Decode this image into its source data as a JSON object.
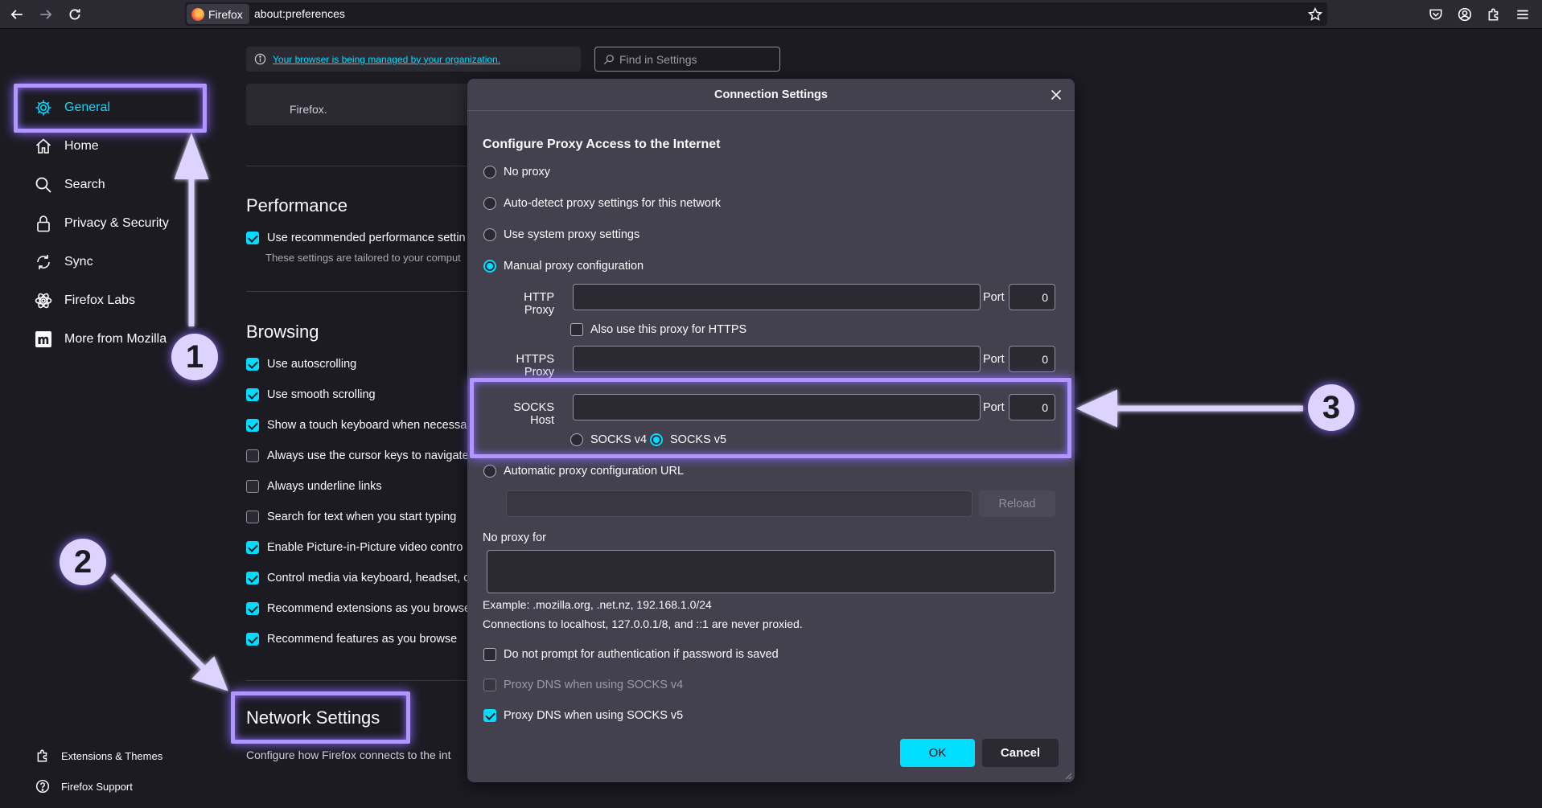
{
  "browser": {
    "identity_label": "Firefox",
    "url": "about:preferences"
  },
  "sidebar": {
    "items": [
      {
        "label": "General",
        "icon": "gear-icon",
        "active": true
      },
      {
        "label": "Home",
        "icon": "home-icon"
      },
      {
        "label": "Search",
        "icon": "search-icon"
      },
      {
        "label": "Privacy & Security",
        "icon": "lock-icon"
      },
      {
        "label": "Sync",
        "icon": "sync-icon"
      },
      {
        "label": "Firefox Labs",
        "icon": "labs-icon"
      },
      {
        "label": "More from Mozilla",
        "icon": "mozilla-icon"
      }
    ],
    "footer": [
      {
        "label": "Extensions & Themes",
        "icon": "puzzle-icon"
      },
      {
        "label": "Firefox Support",
        "icon": "help-icon"
      }
    ]
  },
  "main": {
    "managed_notice": "Your browser is being managed by your organization.",
    "find_placeholder": "Find in Settings",
    "partial_box_text": "Firefox.",
    "performance": {
      "title": "Performance",
      "option": "Use recommended performance settin",
      "subtext": "These settings are tailored to your comput"
    },
    "browsing": {
      "title": "Browsing",
      "options": [
        {
          "label": "Use autoscrolling",
          "checked": true
        },
        {
          "label": "Use smooth scrolling",
          "checked": true
        },
        {
          "label": "Show a touch keyboard when necessa",
          "checked": true
        },
        {
          "label": "Always use the cursor keys to navigate",
          "checked": false
        },
        {
          "label": "Always underline links",
          "checked": false
        },
        {
          "label": "Search for text when you start typing",
          "checked": false
        },
        {
          "label": "Enable Picture-in-Picture video contro",
          "checked": true
        },
        {
          "label": "Control media via keyboard, headset, c",
          "checked": true
        },
        {
          "label": "Recommend extensions as you browse",
          "checked": true
        },
        {
          "label": "Recommend features as you browse",
          "checked": true
        }
      ]
    },
    "network": {
      "title": "Network Settings",
      "description": "Configure how Firefox connects to the int"
    }
  },
  "dialog": {
    "title": "Connection Settings",
    "heading": "Configure Proxy Access to the Internet",
    "proxy_options": [
      {
        "label": "No proxy",
        "selected": false
      },
      {
        "label": "Auto-detect proxy settings for this network",
        "selected": false
      },
      {
        "label": "Use system proxy settings",
        "selected": false
      },
      {
        "label": "Manual proxy configuration",
        "selected": true
      }
    ],
    "http_proxy_label": "HTTP Proxy",
    "https_proxy_label": "HTTPS Proxy",
    "socks_host_label": "SOCKS Host",
    "port_label": "Port",
    "http_port": "0",
    "https_port": "0",
    "socks_port": "0",
    "also_https_label": "Also use this proxy for HTTPS",
    "socks_v4_label": "SOCKS v4",
    "socks_v5_label": "SOCKS v5",
    "socks_version_selected": "v5",
    "auto_config_label": "Automatic proxy configuration URL",
    "reload_label": "Reload",
    "no_proxy_label": "No proxy for",
    "example_text": "Example: .mozilla.org, .net.nz, 192.168.1.0/24",
    "localhost_text": "Connections to localhost, 127.0.0.1/8, and ::1 are never proxied.",
    "checkboxes": [
      {
        "label": "Do not prompt for authentication if password is saved",
        "checked": false,
        "disabled": false
      },
      {
        "label": "Proxy DNS when using SOCKS v4",
        "checked": false,
        "disabled": true
      },
      {
        "label": "Proxy DNS when using SOCKS v5",
        "checked": true,
        "disabled": false
      }
    ],
    "ok_label": "OK",
    "cancel_label": "Cancel"
  },
  "annotations": {
    "badge_1": "1",
    "badge_2": "2",
    "badge_3": "3",
    "highlight_color": "#b196ff"
  }
}
